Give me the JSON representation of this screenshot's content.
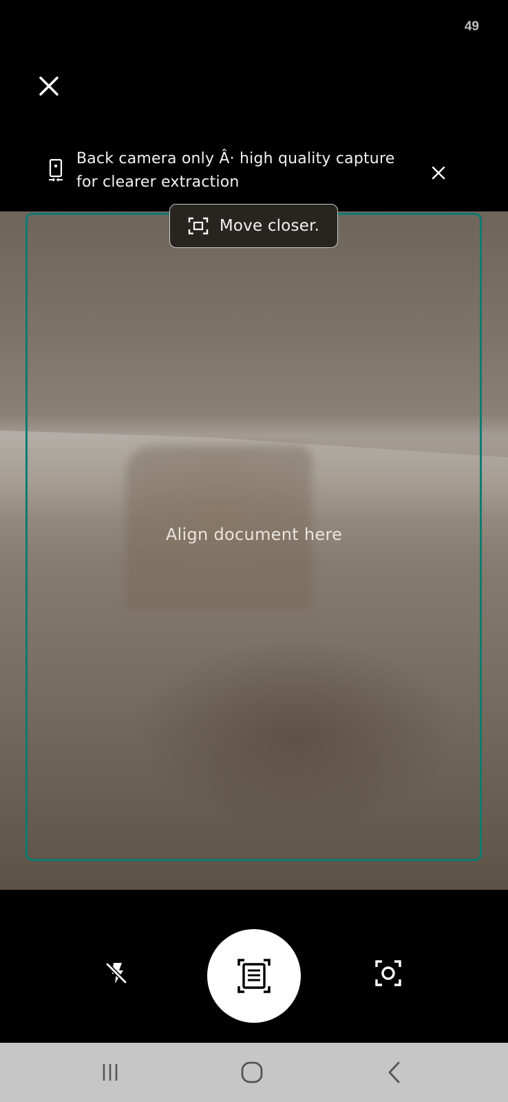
{
  "status_bar": {
    "time": "49"
  },
  "top_bar": {
    "close_icon": "close-icon"
  },
  "banner": {
    "icon": "phone-back-camera-icon",
    "line1": "Back camera only Â· high quality capture",
    "line2": "for clearer extraction",
    "dismiss_icon": "close-icon"
  },
  "viewfinder": {
    "hint_icon": "move-closer-icon",
    "hint_text": "Move closer.",
    "guide_text": "Align document here",
    "frame_color": "#0e7a73"
  },
  "controls": {
    "flash_icon": "flash-off-icon",
    "shutter_icon": "document-scan-icon",
    "mode_icon": "camera-focus-icon"
  },
  "nav_bar": {
    "recents_icon": "recents-icon",
    "home_icon": "home-icon",
    "back_icon": "back-icon"
  }
}
